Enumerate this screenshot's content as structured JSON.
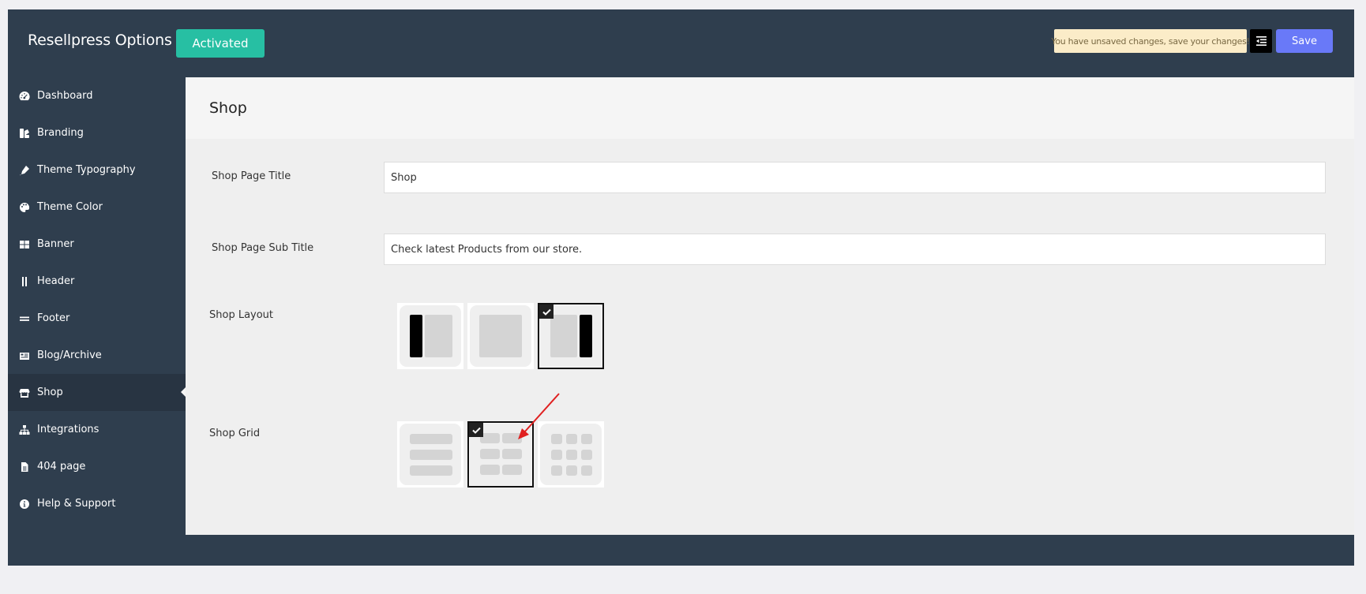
{
  "header": {
    "brand": "Resellpress Options",
    "status_badge": "Activated",
    "unsaved_notice": "You have unsaved changes, save your changes!",
    "save_label": "Save"
  },
  "sidebar": {
    "items": [
      {
        "label": "Dashboard",
        "icon": "dashboard-icon"
      },
      {
        "label": "Branding",
        "icon": "branding-icon"
      },
      {
        "label": "Theme Typography",
        "icon": "pen-icon"
      },
      {
        "label": "Theme Color",
        "icon": "palette-icon"
      },
      {
        "label": "Banner",
        "icon": "banner-icon"
      },
      {
        "label": "Header",
        "icon": "header-icon"
      },
      {
        "label": "Footer",
        "icon": "footer-icon"
      },
      {
        "label": "Blog/Archive",
        "icon": "newspaper-icon"
      },
      {
        "label": "Shop",
        "icon": "store-icon",
        "active": true
      },
      {
        "label": "Integrations",
        "icon": "sitemap-icon"
      },
      {
        "label": "404 page",
        "icon": "file-icon"
      },
      {
        "label": "Help & Support",
        "icon": "info-icon"
      }
    ]
  },
  "content": {
    "section_title": "Shop",
    "shop_page_title": {
      "label": "Shop Page Title",
      "value": "Shop"
    },
    "shop_page_subtitle": {
      "label": "Shop Page Sub Title",
      "value": "Check latest Products from our store."
    },
    "shop_layout": {
      "label": "Shop Layout",
      "selected_index": 2,
      "options": [
        "left-sidebar",
        "no-sidebar",
        "right-sidebar"
      ]
    },
    "shop_grid": {
      "label": "Shop Grid",
      "selected_index": 1,
      "options": [
        "list",
        "grid-2",
        "grid-3"
      ]
    }
  },
  "colors": {
    "frame": "#2f3e4e",
    "activated": "#27bfa3",
    "save": "#6979f8",
    "notice_bg": "#fbecc8",
    "arrow": "#e02020"
  }
}
